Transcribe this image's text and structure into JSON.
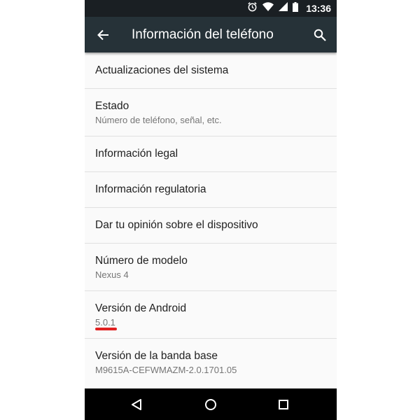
{
  "status_bar": {
    "time": "13:36",
    "icons": [
      "alarm-icon",
      "wifi-icon",
      "signal-icon",
      "battery-icon"
    ]
  },
  "app_bar": {
    "title": "Información del teléfono",
    "back_icon": "arrow-back-icon",
    "search_icon": "search-icon"
  },
  "settings": {
    "items": [
      {
        "title": "Actualizaciones del sistema"
      },
      {
        "title": "Estado",
        "subtitle": "Número de teléfono, señal, etc."
      },
      {
        "title": "Información legal"
      },
      {
        "title": "Información regulatoria"
      },
      {
        "title": "Dar tu opinión sobre el dispositivo"
      },
      {
        "title": "Número de modelo",
        "subtitle": "Nexus 4"
      },
      {
        "title": "Versión de Android",
        "subtitle": "5.0.1"
      },
      {
        "title": "Versión de la banda base",
        "subtitle": "M9615A-CEFWMAZM-2.0.1701.05"
      }
    ]
  },
  "annotation": {
    "underline_color": "#e02020"
  },
  "nav_bar": {
    "icons": [
      "back-triangle-icon",
      "home-circle-icon",
      "recents-square-icon"
    ]
  },
  "colors": {
    "status_bar": "#1a1f23",
    "app_bar": "#263238",
    "background": "#fafafa",
    "primary_text": "#212121",
    "secondary_text": "#757575",
    "divider": "#e0e0e0"
  }
}
